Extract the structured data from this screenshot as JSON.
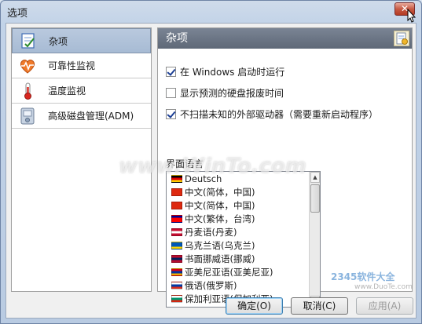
{
  "window": {
    "title": "选项",
    "close_label": "✕"
  },
  "sidebar": {
    "items": [
      {
        "label": "杂项",
        "icon": "notepad-icon",
        "selected": true
      },
      {
        "label": "可靠性监视",
        "icon": "heartbeat-icon",
        "selected": false
      },
      {
        "label": "温度监视",
        "icon": "thermometer-icon",
        "selected": false
      },
      {
        "label": "高级磁盘管理(ADM)",
        "icon": "disk-drive-icon",
        "selected": false
      }
    ]
  },
  "panel": {
    "title": "杂项",
    "options": [
      {
        "label": "在 Windows 启动时运行",
        "checked": true
      },
      {
        "label": "显示预测的硬盘报废时间",
        "checked": false
      },
      {
        "label": "不扫描未知的外部驱动器（需要重新启动程序）",
        "checked": true
      }
    ],
    "language_section_label": "界面语言",
    "languages": [
      {
        "label": "Deutsch",
        "flag": [
          "#000000",
          "#dd0000",
          "#ffce00"
        ]
      },
      {
        "label": "中文(简体，中国)",
        "flag": [
          "#de2910",
          "#de2910",
          "#de2910"
        ]
      },
      {
        "label": "中文(简体，中国)",
        "flag": [
          "#de2910",
          "#de2910",
          "#de2910"
        ]
      },
      {
        "label": "中文(繁体，台湾)",
        "flag": [
          "#000095",
          "#fe0000",
          "#fe0000"
        ]
      },
      {
        "label": "丹麦语(丹麦)",
        "flag": [
          "#c60c30",
          "#ffffff",
          "#c60c30"
        ]
      },
      {
        "label": "乌克兰语(乌克兰)",
        "flag": [
          "#0057b7",
          "#0057b7",
          "#ffd700"
        ]
      },
      {
        "label": "书面挪威语(挪威)",
        "flag": [
          "#ba0c2f",
          "#00205b",
          "#ba0c2f"
        ]
      },
      {
        "label": "亚美尼亚语(亚美尼亚)",
        "flag": [
          "#d90012",
          "#0033a0",
          "#f2a800"
        ]
      },
      {
        "label": "俄语(俄罗斯)",
        "flag": [
          "#ffffff",
          "#0039a6",
          "#d52b1e"
        ]
      },
      {
        "label": "保加利亚语(保加利亚)",
        "flag": [
          "#ffffff",
          "#00966e",
          "#d62612"
        ]
      }
    ]
  },
  "buttons": {
    "ok": "确定(O)",
    "cancel": "取消(C)",
    "apply": "应用(A)"
  },
  "watermarks": {
    "center": "www.WinTo.com",
    "logo": "2345软件大全",
    "url": "www.DuoTe.com"
  },
  "colors": {
    "selected_bg": "#a7bbd4",
    "panel_header": "#5e6877",
    "accent": "#1c3f94"
  }
}
